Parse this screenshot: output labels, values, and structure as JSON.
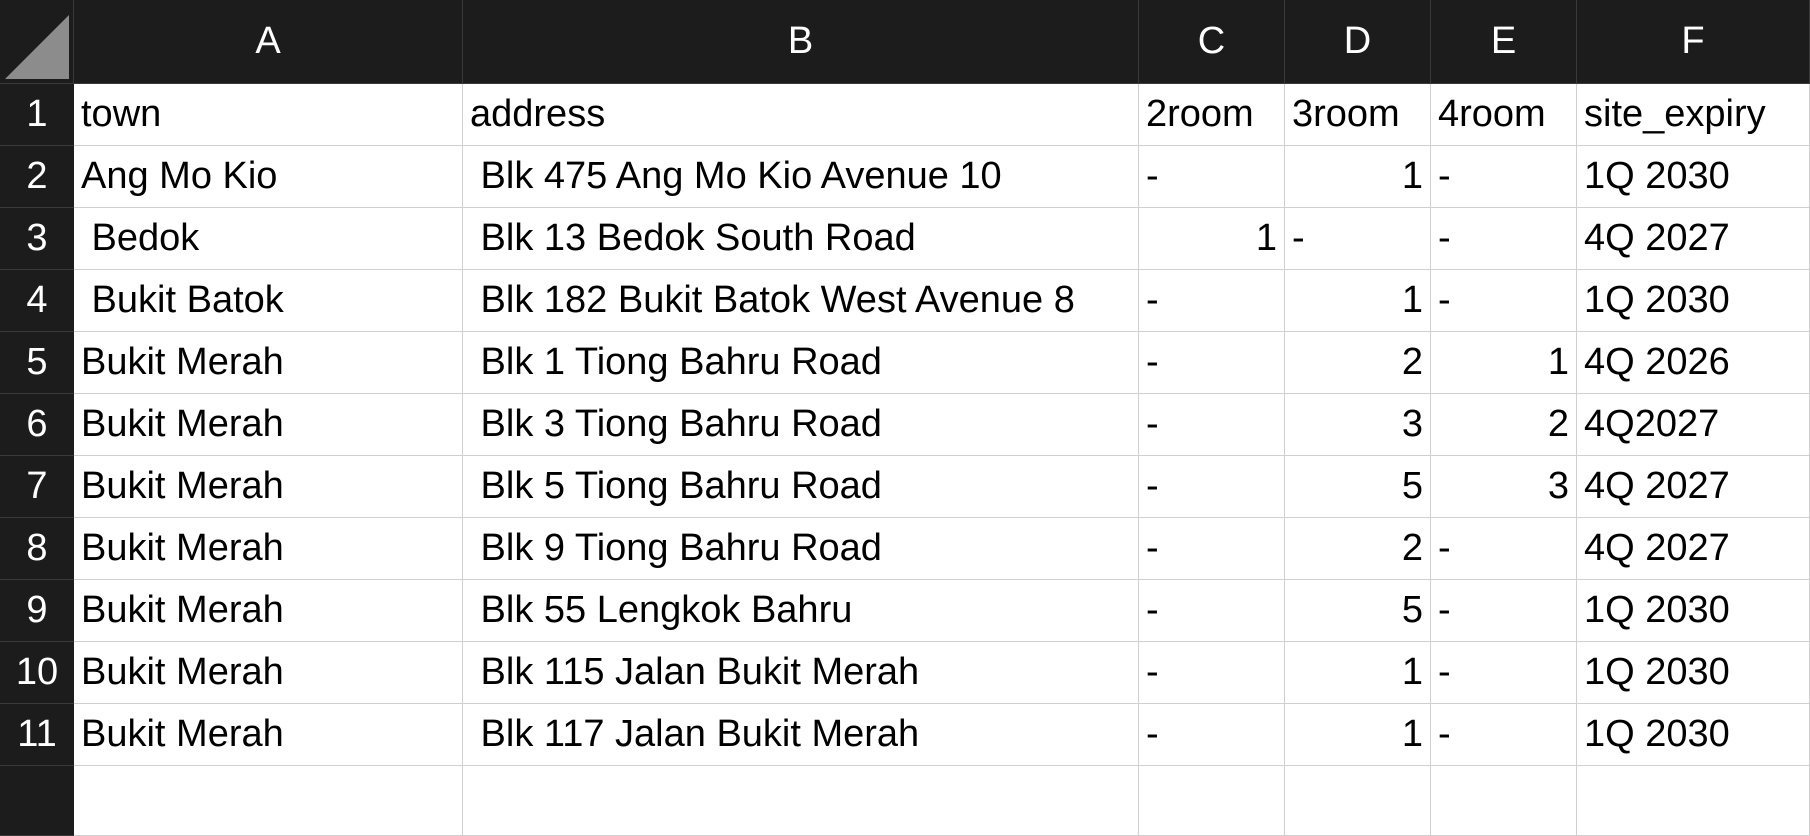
{
  "column_headers": [
    "A",
    "B",
    "C",
    "D",
    "E",
    "F"
  ],
  "row_headers": [
    "1",
    "2",
    "3",
    "4",
    "5",
    "6",
    "7",
    "8",
    "9",
    "10",
    "11"
  ],
  "rows": [
    [
      "town",
      "address",
      "2room",
      "3room",
      "4room",
      "site_expiry"
    ],
    [
      "Ang Mo Kio",
      " Blk 475 Ang Mo Kio Avenue 10",
      "-",
      "1",
      "-",
      "1Q 2030"
    ],
    [
      " Bedok",
      " Blk 13 Bedok South Road",
      "1",
      "-",
      "-",
      "4Q 2027"
    ],
    [
      " Bukit Batok",
      " Blk 182 Bukit Batok West Avenue 8",
      "-",
      "1",
      "-",
      "1Q 2030"
    ],
    [
      "Bukit Merah",
      " Blk 1 Tiong Bahru Road",
      "-",
      "2",
      "1",
      "4Q 2026"
    ],
    [
      "Bukit Merah",
      " Blk 3 Tiong Bahru Road",
      "-",
      "3",
      "2",
      "4Q2027"
    ],
    [
      "Bukit Merah",
      " Blk 5 Tiong Bahru Road",
      "-",
      "5",
      "3",
      "4Q 2027"
    ],
    [
      "Bukit Merah",
      " Blk 9 Tiong Bahru Road",
      "-",
      "2",
      "-",
      "4Q 2027"
    ],
    [
      "Bukit Merah",
      " Blk 55 Lengkok Bahru",
      "-",
      "5",
      "-",
      "1Q 2030"
    ],
    [
      "Bukit Merah",
      " Blk 115 Jalan Bukit Merah",
      "-",
      "1",
      "-",
      "1Q 2030"
    ],
    [
      "Bukit Merah",
      " Blk 117 Jalan Bukit Merah",
      "-",
      "1",
      "-",
      "1Q 2030"
    ]
  ],
  "colors": {
    "header_bg": "#1c1c1c",
    "header_text": "#ffffff",
    "gridline": "#d0d0d0",
    "cell_bg": "#ffffff"
  }
}
